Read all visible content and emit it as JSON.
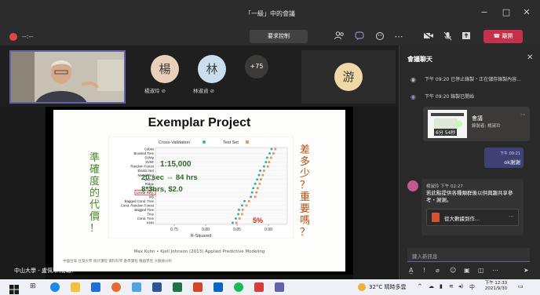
{
  "window": {
    "title": "「一級」中的會議",
    "minimize": "−",
    "maximize": "□",
    "close": "✕"
  },
  "toolbar": {
    "timer": "--:--",
    "request_control": "要求控制",
    "leave_label": "離開",
    "icons": [
      "people-icon",
      "chat-icon",
      "reactions-icon",
      "more-icon",
      "camera-off-icon",
      "mic-off-icon",
      "share-icon",
      "phone-icon"
    ]
  },
  "participants": {
    "self_name": "",
    "people": [
      {
        "initial": "楊",
        "name": "楊淑玲",
        "color": "#e9d0ba"
      },
      {
        "initial": "林",
        "name": "林淑貞",
        "color": "#c9dff0"
      }
    ],
    "more_count": "+75",
    "you_initial": "游",
    "you_color": "#f0d9a6"
  },
  "slide": {
    "title": "Exemplar Project",
    "left_vertical": [
      "準",
      "確",
      "度",
      "的",
      "代",
      "價",
      "！"
    ],
    "right_vertical": [
      "差",
      "多",
      "少",
      "？",
      "重",
      "要",
      "嗎",
      "？"
    ],
    "reference": "Max Kuhn • Kjell Johnson (2013) Applied Predictive Modeling",
    "footer_note": "中國台灣 台灣大學 統計課程 資料科學 數學課程 機器學習 大數據分析",
    "speaker": "中山大學 - 盧佩琳(簡報)"
  },
  "chart_data": {
    "type": "scatter",
    "title": "",
    "legend": [
      "Cross-Validation",
      "Test Set"
    ],
    "xlabel": "R-Squared",
    "x_ticks": [
      "0.75",
      "0.80",
      "0.85",
      "0.90"
    ],
    "xlim": [
      0.72,
      0.93
    ],
    "categories": [
      "Cubist",
      "Boosted Tree",
      "SVMp",
      "SVMr",
      "Random Forest",
      "Elastic Net",
      "Neural Net",
      "MARS",
      "Ridge",
      "PLS",
      "Linear Reg.",
      "M5",
      "Bagged Cond. Tree",
      "Cond. Random Forest",
      "Bagged Tree",
      "Tree",
      "Cond. Tree",
      "KNN"
    ],
    "series": [
      {
        "name": "Cross-Validation",
        "color": "#3ab29a",
        "values": [
          0.905,
          0.902,
          0.898,
          0.896,
          0.893,
          0.887,
          0.885,
          0.882,
          0.879,
          0.876,
          0.874,
          0.872,
          0.862,
          0.858,
          0.853,
          0.852,
          0.848,
          0.843
        ]
      },
      {
        "name": "Test Set",
        "color": "#e8965a",
        "values": [
          0.911,
          0.908,
          0.904,
          0.901,
          0.899,
          0.893,
          0.891,
          0.888,
          0.886,
          0.883,
          0.881,
          0.879,
          0.869,
          0.865,
          0.859,
          0.858,
          0.854,
          0.849
        ]
      }
    ],
    "annotations": {
      "time": "1:15,000",
      "cost": "20 sec ⇔ 84 hrs",
      "compute": "8*3hrs, $2.0",
      "percent": "5%"
    }
  },
  "chat": {
    "title": "會議聊天",
    "system": [
      {
        "time": "下午 09:20",
        "text": "已停止錄製・正在儲存錄製內容..."
      },
      {
        "time": "下午 09:20",
        "text": "錄製已開始"
      }
    ],
    "recording": {
      "duration": "6分 54秒",
      "title": "會議",
      "subtitle": "錄製者: 楊淑玲"
    },
    "my_message": {
      "time": "下午 09:21",
      "text": "ok謝謝"
    },
    "other_message": {
      "sender": "楊淑玲",
      "time": "下午 02:27",
      "text": "若此點提供各種類群後以供興趣共享參考・謝謝。",
      "file": "從大數據到作..."
    },
    "input_placeholder": "鍵入新訊息"
  },
  "taskbar": {
    "weather": "32°C 晴時多雲",
    "ime": "中",
    "time": "下午 12:33",
    "date": "2021/9/30"
  }
}
